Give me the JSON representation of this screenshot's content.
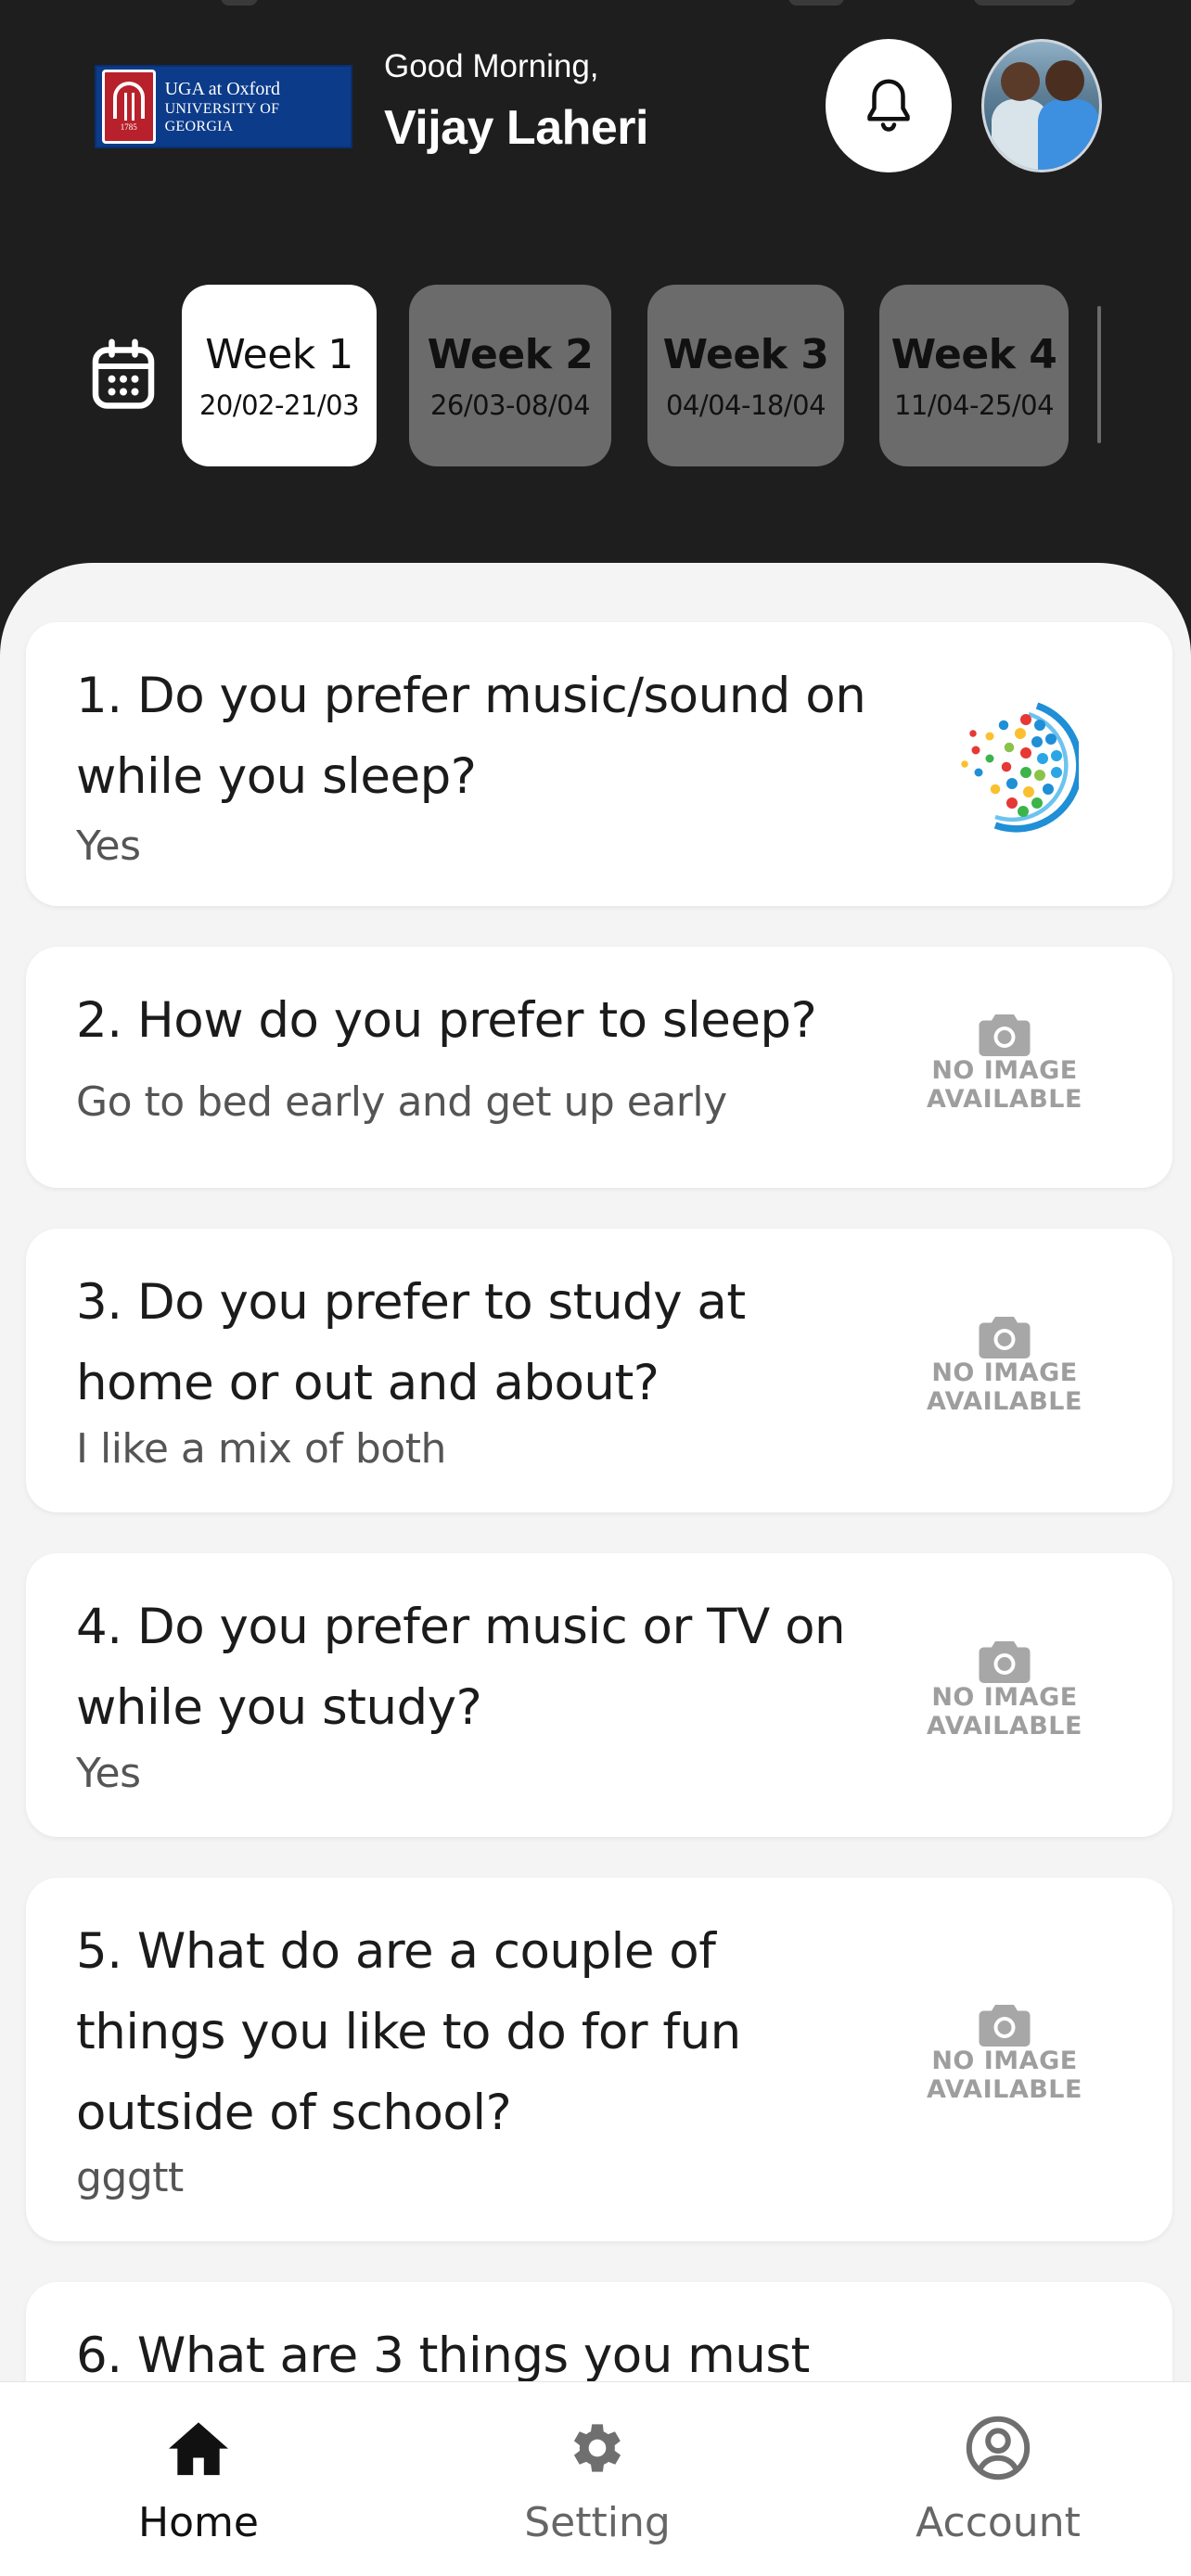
{
  "header": {
    "logo": {
      "line1": "UGA at Oxford",
      "line2": "UNIVERSITY OF GEORGIA",
      "seal_year": "1785",
      "brand_color": "#0c3b8a",
      "seal_color": "#b8212b"
    },
    "greeting": "Good Morning,",
    "user_name": "Vijay Laheri",
    "notification_icon": "bell-icon",
    "avatar_alt": "user-avatar"
  },
  "weeks": {
    "calendar_icon": "calendar-icon",
    "items": [
      {
        "title": "Week 1",
        "range": "20/02-21/03",
        "active": true
      },
      {
        "title": "Week 2",
        "range": "26/03-08/04",
        "active": false
      },
      {
        "title": "Week 3",
        "range": "04/04-18/04",
        "active": false
      },
      {
        "title": "Week 4",
        "range": "11/04-25/04",
        "active": false
      }
    ]
  },
  "questions": [
    {
      "question": "1. Do you prefer music/sound on while you sleep?",
      "answer": "Yes",
      "image": "globe-logo"
    },
    {
      "question": "2. How do you prefer to sleep?",
      "answer": "Go to bed early and get up early",
      "image": "no-image"
    },
    {
      "question": "3. Do you prefer to study at home or out and about?",
      "answer": "I like a mix of both",
      "image": "no-image"
    },
    {
      "question": "4. Do you prefer music or TV on while you study?",
      "answer": "Yes",
      "image": "no-image"
    },
    {
      "question": "5. What do are a couple of things you like to do for fun outside of school?",
      "answer": "gggtt",
      "image": "no-image"
    },
    {
      "question": "6. What are 3 things you must",
      "answer": "",
      "image": "globe-logo"
    }
  ],
  "no_image_text": {
    "line1": "NO IMAGE",
    "line2": "AVAILABLE"
  },
  "bottom_nav": [
    {
      "label": "Home",
      "icon": "home-icon",
      "active": true
    },
    {
      "label": "Setting",
      "icon": "gear-icon",
      "active": false
    },
    {
      "label": "Account",
      "icon": "account-circle-icon",
      "active": false
    }
  ],
  "colors": {
    "header_bg": "#1e1e1f",
    "panel_bg": "#f4f4f4",
    "week_inactive": "#6b6b6b",
    "week_active": "#ffffff"
  }
}
